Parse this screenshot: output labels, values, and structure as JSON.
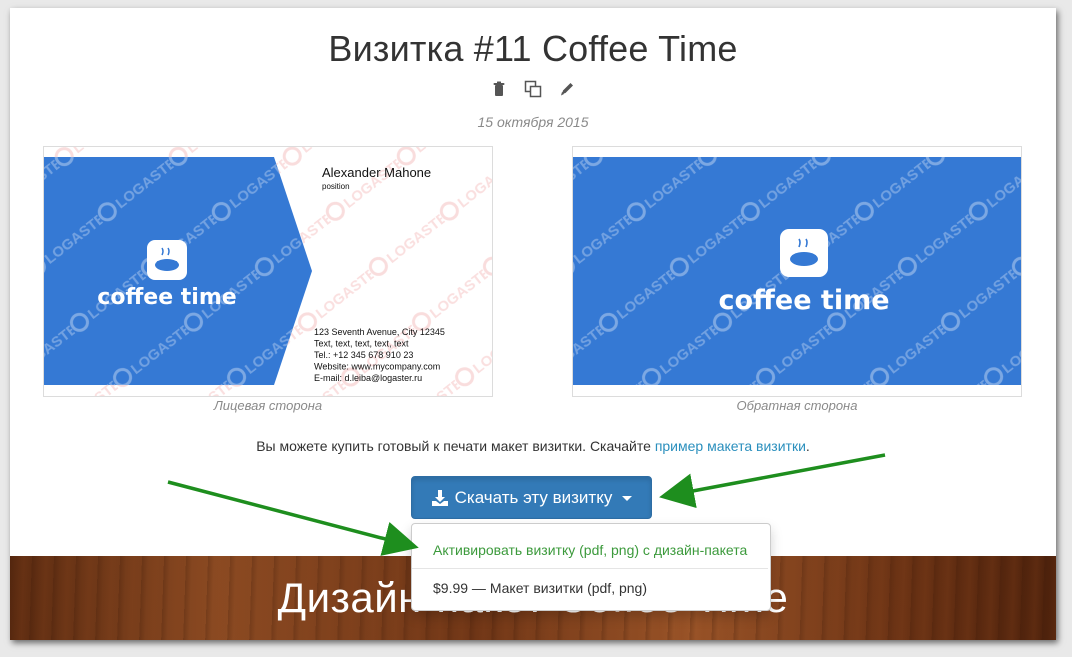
{
  "page": {
    "title": "Визитка #11 Coffee Time",
    "date": "15 октября 2015"
  },
  "toolbar": {
    "icons": [
      "trash-icon",
      "copy-icon",
      "pencil-icon"
    ]
  },
  "cards": {
    "front": {
      "caption": "Лицевая сторона",
      "logo_text": "coffee time",
      "name": "Alexander Mahone",
      "position": "position",
      "address_lines": [
        "123 Seventh Avenue, City 12345",
        "Text, text, text, text, text",
        "Tel.: +12 345 678 910 23",
        "Website: www.mycompany.com",
        "E-mail: d.leiba@logaster.ru"
      ],
      "watermark": "LOGASTER"
    },
    "back": {
      "caption": "Обратная сторона",
      "logo_text": "coffee time",
      "watermark": "LOGASTER"
    }
  },
  "info": {
    "text": "Вы можете купить готовый к печати макет визитки. Скачайте ",
    "link": "пример макета визитки",
    "suffix": "."
  },
  "download": {
    "label": "Скачать эту визитку",
    "menu": [
      "Активировать визитку (pdf, png) с дизайн-пакета",
      "$9.99 — Макет визитки (pdf, png)"
    ]
  },
  "wood_banner": {
    "title": "Дизайн-пакет Coffee Time"
  },
  "colors": {
    "card_blue": "#3579d4",
    "button_blue": "#337ab7",
    "link": "#2a8fbd",
    "menu_active": "#3c9a3c",
    "arrow_green": "#1e8e1e"
  }
}
